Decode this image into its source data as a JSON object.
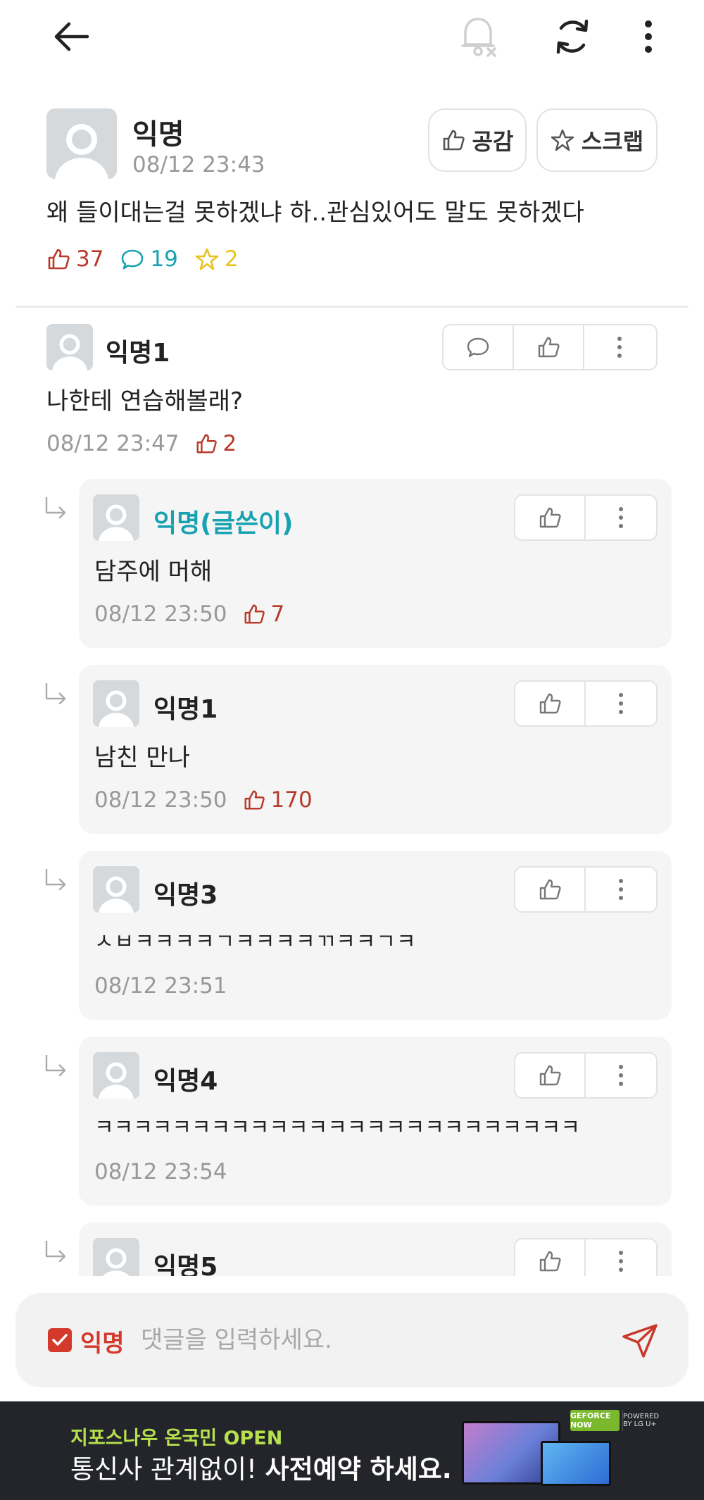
{
  "topbar": {
    "back_icon": "arrow-left-icon",
    "bell_icon": "bell-off-icon",
    "refresh_icon": "refresh-icon",
    "more_icon": "more-vertical-icon"
  },
  "post": {
    "author": "익명",
    "time": "08/12 23:43",
    "empathy_label": "공감",
    "scrap_label": "스크랩",
    "body": "왜 들이대는걸 못하겠냐 하..관심있어도 말도 못하겠다",
    "likes": "37",
    "comments": "19",
    "scraps": "2"
  },
  "comments": [
    {
      "author": "익명1",
      "text": "나한테 연습해볼래?",
      "time": "08/12 23:47",
      "likes": "2"
    }
  ],
  "replies": [
    {
      "author": "익명(글쓴이)",
      "text": "담주에 머해",
      "time": "08/12 23:50",
      "likes": "7",
      "is_op": true
    },
    {
      "author": "익명1",
      "text": "남친 만나",
      "time": "08/12 23:50",
      "likes": "170"
    },
    {
      "author": "익명3",
      "text": "ㅅㅂㅋㅋㅋㅋㄱㅋㅋㅋㅋㄲㅋㅋㄱㅋ",
      "time": "08/12 23:51",
      "likes": ""
    },
    {
      "author": "익명4",
      "text": "ㅋㅋㅋㅋㅋㅋㅋㅋㅋㅋㅋㅋㅋㅋㅋㅋㅋㅋㅋㅋㅋㅋㅋㅋㅋ",
      "time": "08/12 23:54",
      "likes": ""
    },
    {
      "author": "익명5",
      "text": "",
      "time": "",
      "likes": ""
    }
  ],
  "input": {
    "anonymous_label": "익명",
    "anonymous_checked": true,
    "placeholder": "댓글을 입력하세요."
  },
  "ad": {
    "line1": "지포스나우 온국민 OPEN",
    "line2_prefix": "통신사 관계없이! ",
    "line2_bold": "사전예약 하세요.",
    "badge1": "GEFORCE NOW",
    "badge2": "POWERED BY LG U+"
  },
  "colors": {
    "accent_red": "#d33a2c",
    "like_red": "#b73a2a",
    "comment_teal": "#17a2b2",
    "scrap_yellow": "#e8c21e",
    "op_teal": "#17a2b2"
  }
}
